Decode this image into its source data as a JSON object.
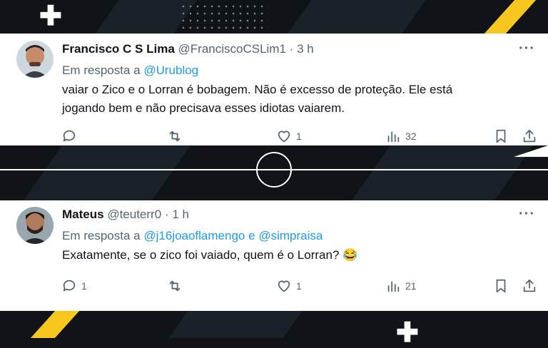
{
  "tweets": [
    {
      "display_name": "Francisco C S Lima",
      "handle": "@FranciscoCSLim1",
      "separator": "·",
      "time": "3 h",
      "reply_prefix": "Em resposta a",
      "reply_to": [
        "@Urublog"
      ],
      "reply_join": "",
      "text_lines": [
        "vaiar o Zico e o Lorran é bobagem. Não é excesso de proteção. Ele está",
        "jogando bem e não precisava esses idiotas vaiarem."
      ],
      "reply_count": "",
      "retweet_count": "",
      "like_count": "1",
      "view_count": "32"
    },
    {
      "display_name": "Mateus",
      "handle": "@teuterr0",
      "separator": "·",
      "time": "1 h",
      "reply_prefix": "Em resposta a",
      "reply_to": [
        "@j16joaoflamengo",
        "@simpraisa"
      ],
      "reply_join": "e",
      "text_lines": [
        "Exatamente, se o zico foi vaiado, quem é o Lorran? 😂"
      ],
      "reply_count": "1",
      "retweet_count": "",
      "like_count": "1",
      "view_count": "21"
    }
  ],
  "icons": {
    "more": "more-icon",
    "reply": "reply-icon",
    "retweet": "retweet-icon",
    "like": "heart-icon",
    "views": "views-icon",
    "bookmark": "bookmark-icon",
    "share": "share-icon"
  },
  "colors": {
    "link": "#1d9bf0",
    "muted": "#536471",
    "text": "#0f1419",
    "background_dark": "#101418",
    "accent_yellow": "#f7c71e"
  },
  "more_glyph": "···"
}
